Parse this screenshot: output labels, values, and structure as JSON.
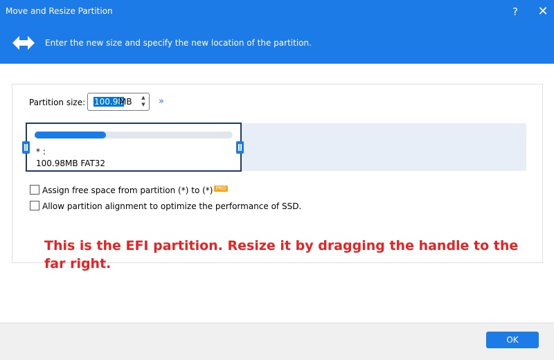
{
  "window": {
    "title": "Move and Resize Partition",
    "help_label": "?",
    "close_label": "✕"
  },
  "banner": {
    "text": "Enter the new size and specify the new location of the partition.",
    "icon": "resize-arrows-icon"
  },
  "partition_size": {
    "label": "Partition size:",
    "value": "100.98",
    "unit": "MB",
    "expand_label": "»"
  },
  "partition": {
    "name": "* :",
    "info": "100.98MB FAT32",
    "usage_fraction": 0.36
  },
  "options": [
    {
      "label": "Assign free space from partition (*) to (*)",
      "checked": false,
      "badge": "PRO"
    },
    {
      "label": "Allow partition alignment to optimize the performance of SSD.",
      "checked": false
    }
  ],
  "note": "This is the EFI partition. Resize it by dragging the handle to the far right.",
  "footer": {
    "ok_label": "OK"
  },
  "colors": {
    "accent": "#1c7be6",
    "note": "#e42424"
  }
}
